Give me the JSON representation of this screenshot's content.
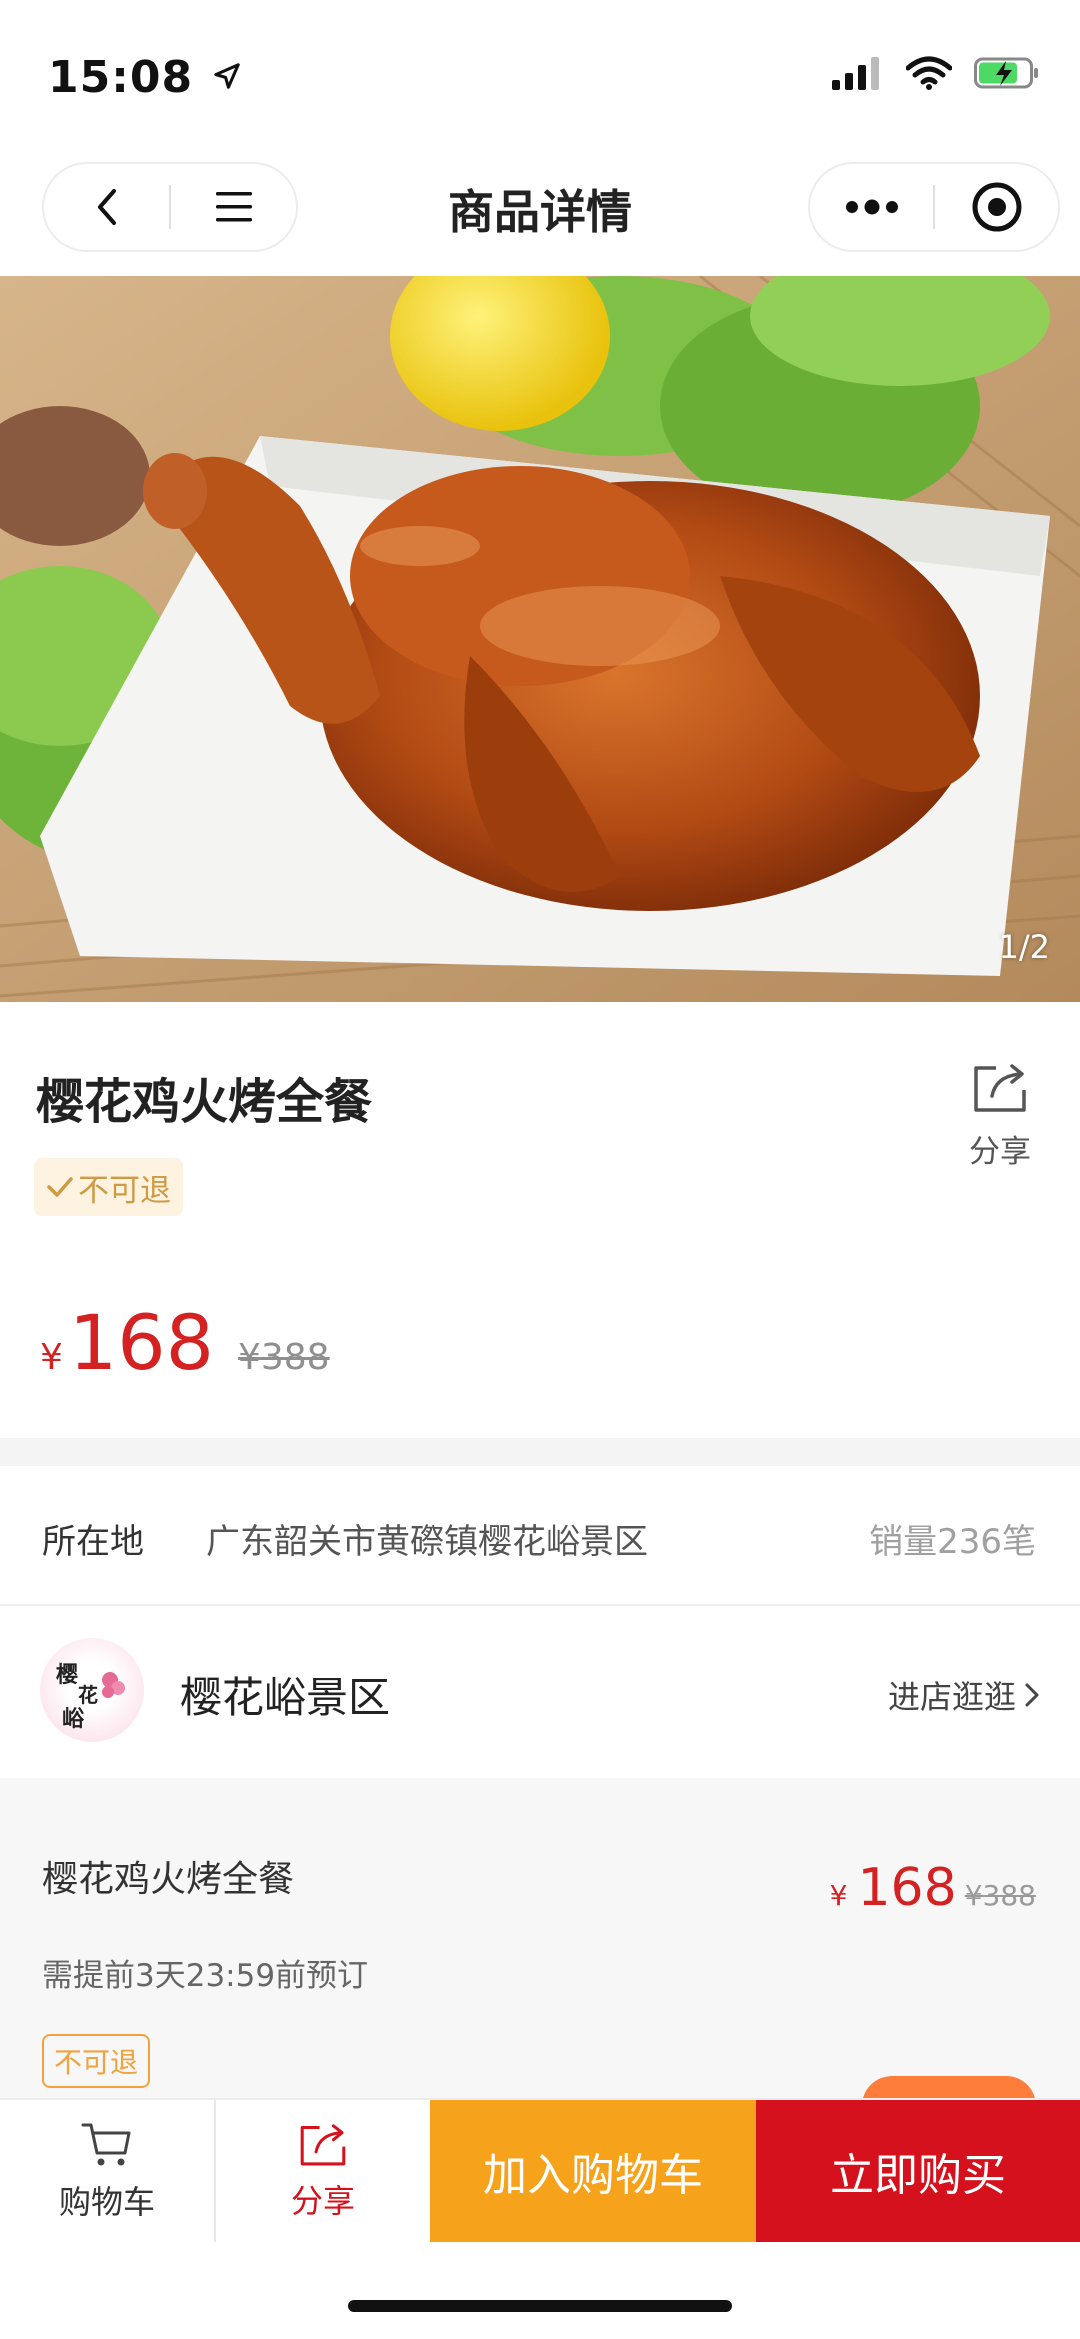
{
  "status_bar": {
    "time": "15:08"
  },
  "nav": {
    "title": "商品详情"
  },
  "hero": {
    "pager": "1/2"
  },
  "product": {
    "title": "樱花鸡火烤全餐",
    "share_label": "分享",
    "tag": "不可退",
    "price_symbol": "¥",
    "price": "168",
    "original_price": "¥388"
  },
  "location": {
    "label": "所在地",
    "value": "广东韶关市黄磜镇樱花峪景区",
    "sales": "销量236笔"
  },
  "shop": {
    "logo_text": "樱花峪",
    "name": "樱花峪景区",
    "enter_label": "进店逛逛"
  },
  "sku": {
    "name": "樱花鸡火烤全餐",
    "note": "需提前3天23:59前预订",
    "tag": "不可退",
    "price_symbol": "¥",
    "price": "168",
    "original_price": "¥388"
  },
  "bottom_bar": {
    "cart_label": "购物车",
    "share_label": "分享",
    "add_to_cart": "加入购物车",
    "buy_now": "立即购买"
  },
  "colors": {
    "price_red": "#d42121",
    "add_to_cart_orange": "#f7a21b",
    "buy_red": "#d4111c",
    "tag_gold": "#cf9a44"
  },
  "icons": [
    "location-arrow-icon",
    "signal-icon",
    "wifi-icon",
    "battery-icon",
    "back-icon",
    "menu-icon",
    "more-icon",
    "target-icon",
    "share-icon",
    "check-icon",
    "chevron-right-icon",
    "cart-icon"
  ]
}
